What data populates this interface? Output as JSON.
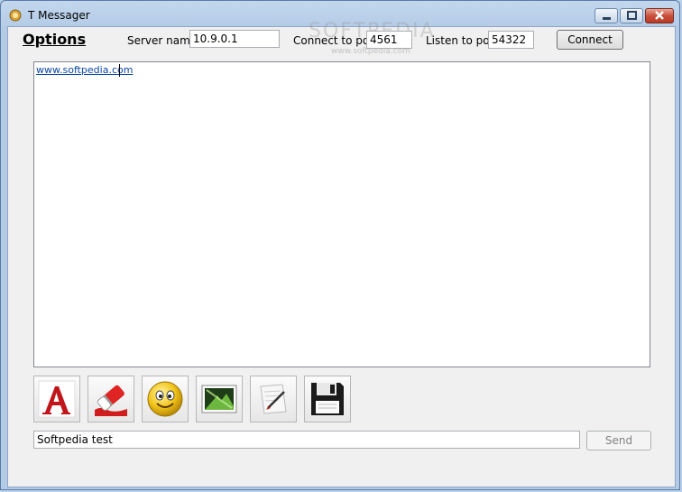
{
  "window": {
    "title": "T Messager"
  },
  "header": {
    "options_label": "Options",
    "server_name_label": "Server name:",
    "server_name_value": "10.9.0.1",
    "connect_port_label": "Connect to port:",
    "connect_port_value": "4561",
    "listen_port_label": "Listen to port:",
    "listen_port_value": "54322",
    "connect_button": "Connect"
  },
  "messages": {
    "link_text": "www.softpedia.com"
  },
  "toolbar": {
    "tools": [
      "font-icon",
      "eraser-icon",
      "smiley-icon",
      "image-icon",
      "signature-icon",
      "save-icon"
    ]
  },
  "compose": {
    "value": "Softpedia test",
    "send_button": "Send"
  },
  "watermark": {
    "text": "SOFTPEDIA",
    "sub": "www.softpedia.com"
  }
}
